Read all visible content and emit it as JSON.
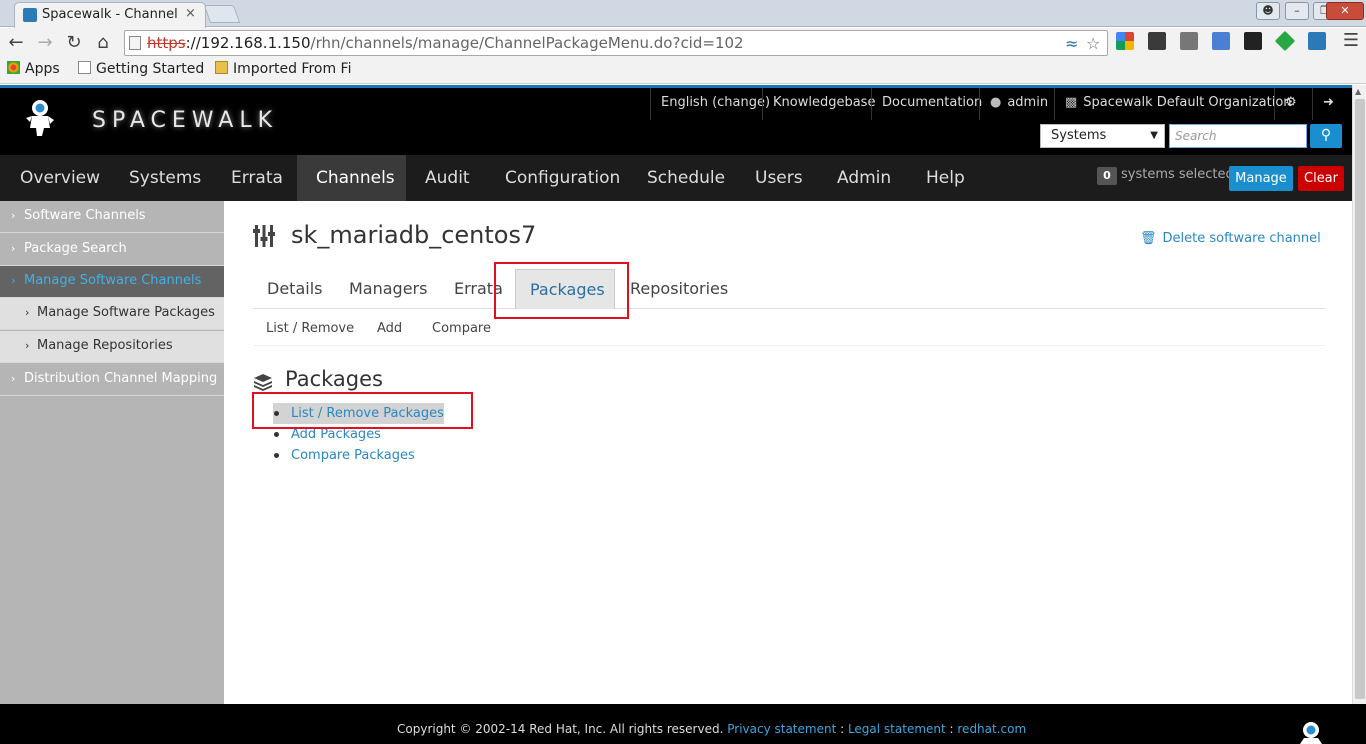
{
  "browser": {
    "tab_title": "Spacewalk - Channel",
    "tab_close": "×",
    "url_protocol": "https",
    "url_host": "://192.168.1.150",
    "url_path": "/rhn/channels/manage/ChannelPackageMenu.do?cid=102",
    "bookmarks": [
      "Apps",
      "Getting Started",
      "Imported From Fi"
    ]
  },
  "header": {
    "logo_text": "SPACEWALK",
    "language": "English (change)",
    "knowledgebase": "Knowledgebase",
    "documentation": "Documentation",
    "user": "admin",
    "organization": "Spacewalk Default Organization",
    "search_scope": "Systems",
    "search_placeholder": "Search"
  },
  "mainnav": {
    "items": [
      "Overview",
      "Systems",
      "Errata",
      "Channels",
      "Audit",
      "Configuration",
      "Schedule",
      "Users",
      "Admin",
      "Help"
    ],
    "active": "Channels",
    "selected_count": "0",
    "selected_label": "systems selected",
    "manage_label": "Manage",
    "clear_label": "Clear"
  },
  "sidebar": {
    "items": [
      {
        "label": "Software Channels"
      },
      {
        "label": "Package Search"
      },
      {
        "label": "Manage Software Channels"
      },
      {
        "label": "Manage Software Packages"
      },
      {
        "label": "Manage Repositories"
      },
      {
        "label": "Distribution Channel Mapping"
      }
    ]
  },
  "content": {
    "title": "sk_mariadb_centos7",
    "delete_link": "Delete software channel",
    "tabs": [
      "Details",
      "Managers",
      "Errata",
      "Packages",
      "Repositories"
    ],
    "active_tab": "Packages",
    "subtabs": [
      "List / Remove",
      "Add",
      "Compare"
    ],
    "section_title": "Packages",
    "links": [
      "List / Remove Packages",
      "Add Packages",
      "Compare Packages"
    ]
  },
  "footer": {
    "copyright": "Copyright © 2002-14 Red Hat, Inc. All rights reserved.",
    "privacy": "Privacy statement",
    "sep1": " : ",
    "legal": "Legal statement",
    "sep2": " : ",
    "redhat": "redhat.com"
  },
  "colors": {
    "accent": "#1a8fd0",
    "link": "#2a87c4",
    "danger": "#cc0000",
    "highlight_box": "#e01020"
  }
}
